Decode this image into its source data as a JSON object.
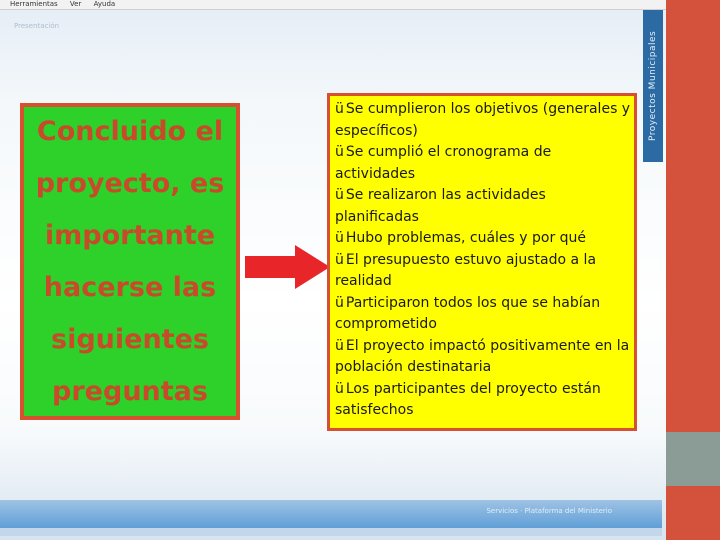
{
  "menubar": {
    "items": [
      "Herramientas",
      "Ver",
      "Ayuda"
    ]
  },
  "window": {
    "title_strip": "Presentación"
  },
  "side_panel": {
    "label": "Proyectos Municipales"
  },
  "footer": {
    "text": "Servicios · Plataforma del Ministerio"
  },
  "green_box": {
    "lines": [
      "Concluido el",
      "proyecto, es",
      "importante",
      "hacerse las",
      "siguientes",
      "preguntas"
    ]
  },
  "yellow_box": {
    "check_glyph": "ü",
    "items": [
      "Se cumplieron los objetivos (generales y específicos)",
      "Se cumplió el cronograma de actividades",
      "Se realizaron las actividades planificadas",
      "Hubo problemas, cuáles y por qué",
      "El presupuesto estuvo ajustado a la realidad",
      "Participaron todos los que se habían comprometido",
      "El proyecto impactó positivamente en la población destinataria",
      "Los participantes del proyecto están satisfechos"
    ]
  },
  "colors": {
    "green": "#2ed12a",
    "yellow": "#ffff00",
    "red_border": "#d75030",
    "arrow": "#e8262a",
    "right_band_red": "#d4523b",
    "right_band_gray": "#8b9b96",
    "side_panel_blue": "#2b6aa3"
  }
}
